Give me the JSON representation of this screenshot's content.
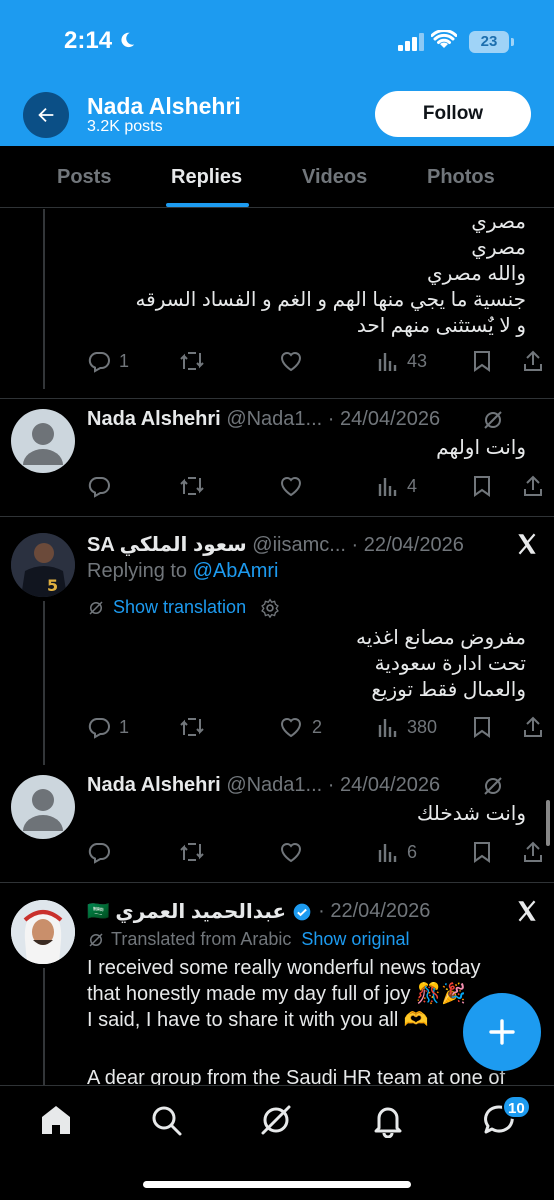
{
  "status_bar": {
    "time": "2:14",
    "battery": "23"
  },
  "header": {
    "name": "Nada Alshehri",
    "posts": "3.2K posts",
    "follow_label": "Follow"
  },
  "tabs": [
    {
      "label": "Posts"
    },
    {
      "label": "Replies",
      "active": true
    },
    {
      "label": "Videos"
    },
    {
      "label": "Photos"
    }
  ],
  "post1": {
    "lines": [
      "مصري",
      "مصري",
      "والله مصري",
      "جنسية ما يجي منها الهم و الغم و الفساد السرقه",
      "و لا يٌستثنى منهم احد"
    ],
    "replies": "1",
    "reposts": "",
    "likes": "",
    "views": "43"
  },
  "reply1": {
    "name": "Nada Alshehri",
    "handle": "@Nada1...",
    "date": "· 24/04/2026",
    "text": "وانت اولهم",
    "replies": "",
    "views": "4"
  },
  "post2": {
    "name": "SA سعود الملكي",
    "handle": "@iisamc...",
    "date": "· 22/04/2026",
    "replying_prefix": "Replying to",
    "replying_to": "@AbAmri",
    "show_translation": "Show translation",
    "lines": [
      "مفروض مصانع اغذيه",
      "تحت ادارة سعودية",
      "والعمال فقط توزيع"
    ],
    "replies": "1",
    "likes": "2",
    "views": "380"
  },
  "reply2": {
    "name": "Nada Alshehri",
    "handle": "@Nada1...",
    "date": "· 24/04/2026",
    "text": "وانت شدخلك",
    "views": "6"
  },
  "post3": {
    "flag": "🇸🇦",
    "name": "عبدالحميد العمري",
    "date": "· 22/04/2026",
    "translated_from": "Translated from Arabic",
    "show_original": "Show original",
    "lines": [
      "I received some really wonderful news today",
      "that honestly made my day full of joy 🎊🎉",
      "I said, I have to share it with you all 🫶",
      "",
      "A dear group from the Saudi HR team at one of"
    ]
  },
  "bottom_nav": {
    "messages_badge": "10"
  },
  "colors": {
    "accent": "#1d9bf0",
    "background": "#000000",
    "muted": "#71767b",
    "separator": "#2f3336"
  },
  "icons": [
    "back-arrow-icon",
    "moon-icon",
    "signal-icon",
    "wifi-icon",
    "reply-icon",
    "repost-icon",
    "like-icon",
    "views-icon",
    "bookmark-icon",
    "share-icon",
    "grok-icon",
    "x-logo-icon",
    "gear-icon",
    "verified-icon",
    "compose-icon",
    "home-icon",
    "search-icon",
    "bell-icon",
    "messages-icon"
  ]
}
